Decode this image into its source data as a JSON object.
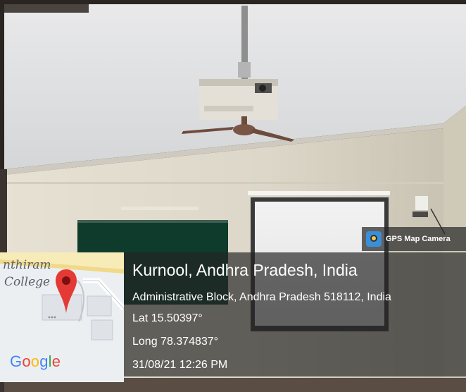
{
  "watermark": {
    "label": "GPS Map Camera",
    "icon": "gps-map-camera-icon"
  },
  "map": {
    "label_line1": "nthiram",
    "label_line2": "College",
    "logo": "Google",
    "logo_colors": [
      "#4285F4",
      "#EA4335",
      "#FBBC05",
      "#4285F4",
      "#34A853",
      "#EA4335"
    ],
    "pin_color": "#e53935"
  },
  "location": {
    "city": "Kurnool, Andhra Pradesh, India",
    "address": "Administrative Block, Andhra Pradesh 518112, India",
    "lat": "Lat 15.50397°",
    "long": "Long 78.374837°",
    "datetime": "31/08/21 12:26 PM"
  }
}
